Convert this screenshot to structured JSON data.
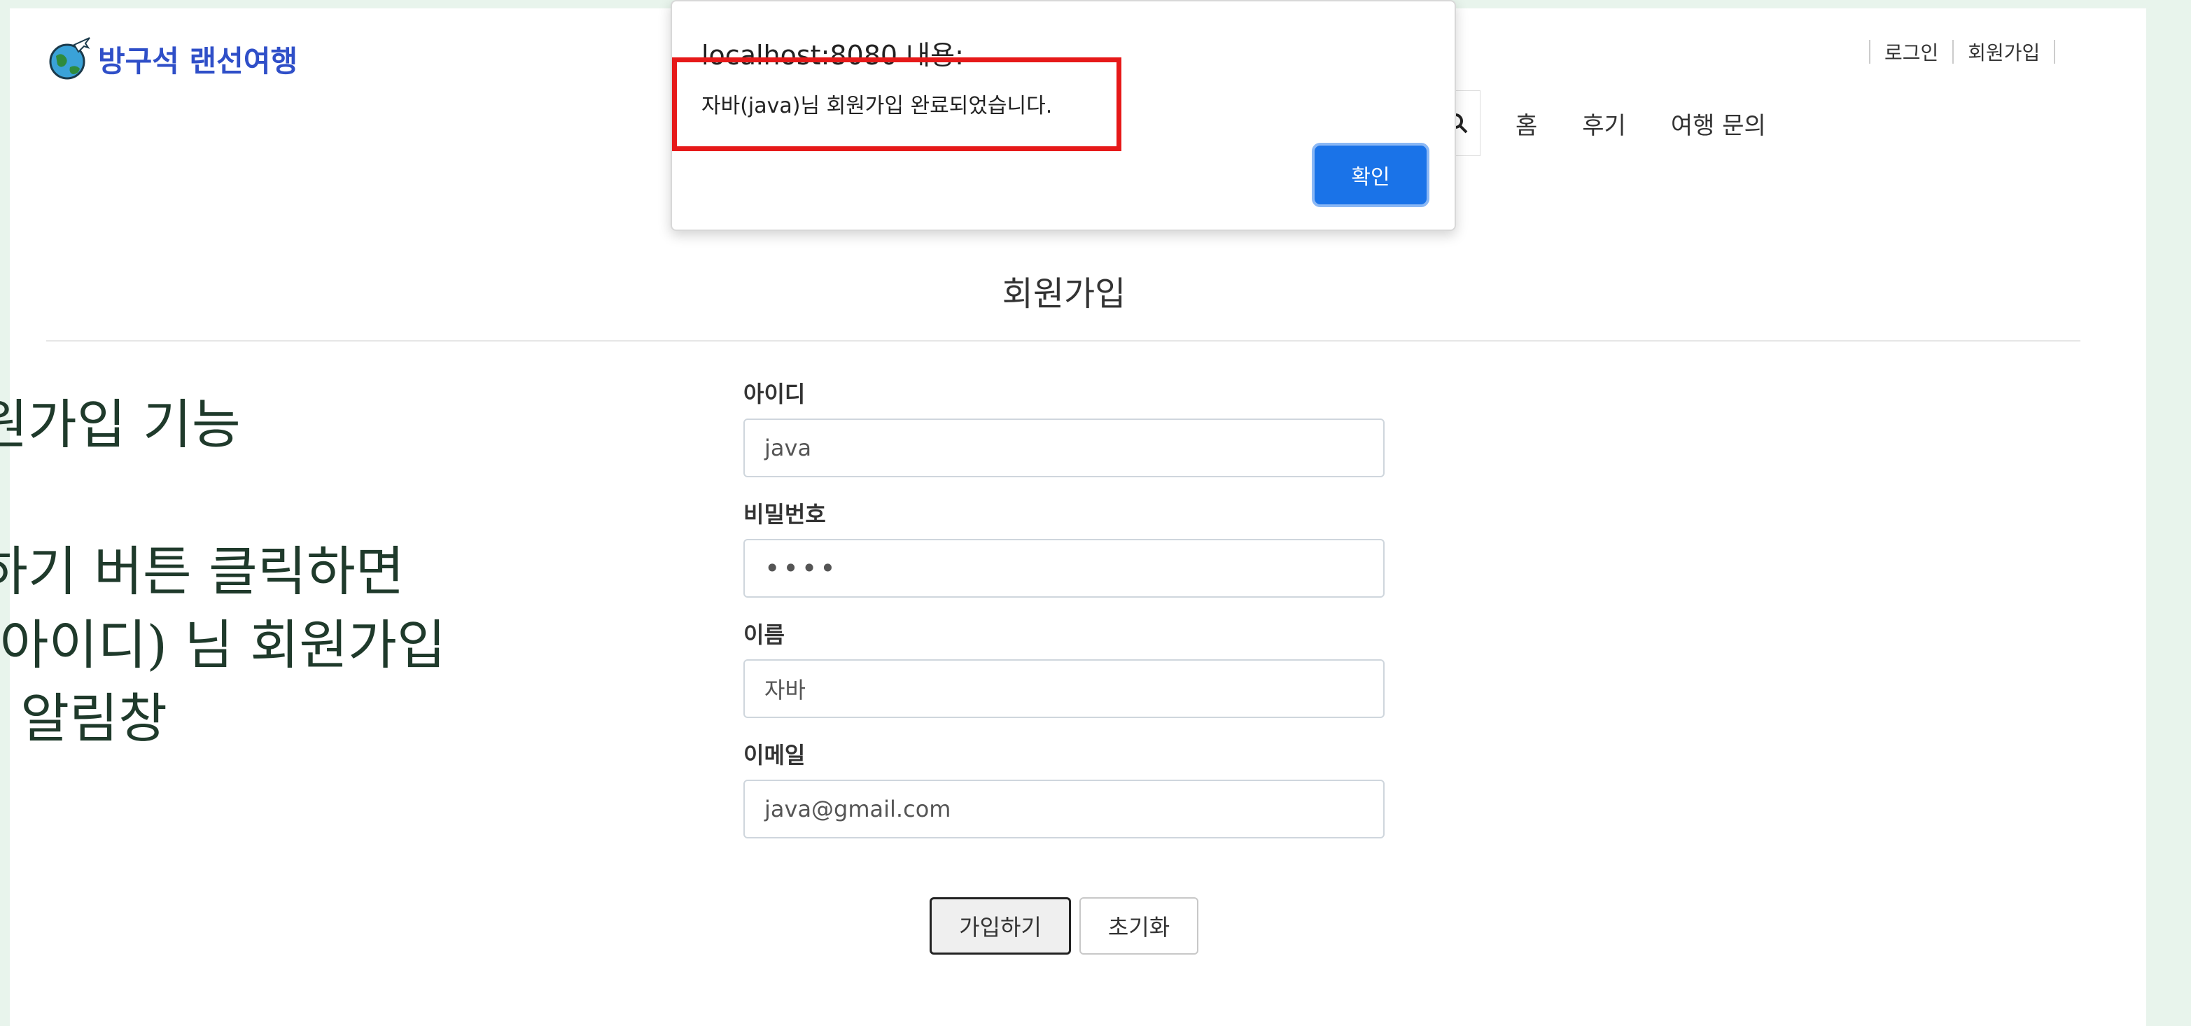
{
  "slide": {
    "title": "원가입 기능",
    "line1": "하기 버튼 클릭하면",
    "line2": "(아이디) 님 회원가입",
    "line3": "\" 알림창"
  },
  "header": {
    "logo_text": "방구석 랜선여행",
    "login": "로그인",
    "signup": "회원가입",
    "nav": [
      "홈",
      "후기",
      "여행 문의"
    ]
  },
  "page": {
    "title": "회원가입"
  },
  "form": {
    "id_label": "아이디",
    "id_value": "java",
    "pw_label": "비밀번호",
    "pw_value": "••••",
    "name_label": "이름",
    "name_value": "자바",
    "email_label": "이메일",
    "email_value": "java@gmail.com",
    "submit_label": "가입하기",
    "reset_label": "초기화"
  },
  "alert": {
    "title": "localhost:8080 내용:",
    "message": "자바(java)님 회원가입 완료되었습니다.",
    "ok_label": "확인"
  },
  "colors": {
    "brand": "#2f4fc8",
    "alert_button": "#1a73e8",
    "highlight": "#e61919"
  }
}
